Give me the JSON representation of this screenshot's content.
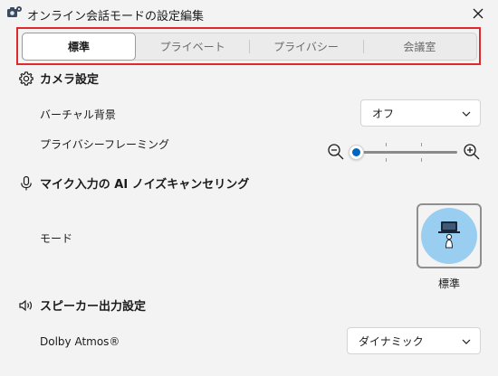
{
  "window": {
    "title": "オンライン会話モードの設定編集",
    "icon": "camera-settings-icon"
  },
  "tabs": [
    {
      "label": "標準",
      "active": true
    },
    {
      "label": "プライベート",
      "active": false
    },
    {
      "label": "プライバシー",
      "active": false
    },
    {
      "label": "会議室",
      "active": false
    }
  ],
  "camera_section": {
    "title": "カメラ設定",
    "icon": "gear-icon",
    "virtual_background": {
      "label": "バーチャル背景",
      "value": "オフ"
    },
    "privacy_framing": {
      "label": "プライバシーフレーミング",
      "level": 0.0
    }
  },
  "mic_section": {
    "title": "マイク入力の AI ノイズキャンセリング",
    "icon": "microphone-icon",
    "mode": {
      "label": "モード",
      "selected": "標準"
    }
  },
  "speaker_section": {
    "title": "スピーカー出力設定",
    "icon": "speaker-icon",
    "dolby": {
      "label": "Dolby Atmos®",
      "value": "ダイナミック"
    }
  },
  "colors": {
    "accent": "#0067c0",
    "highlight_border": "#e0292f",
    "mode_circle": "#99cef1"
  }
}
